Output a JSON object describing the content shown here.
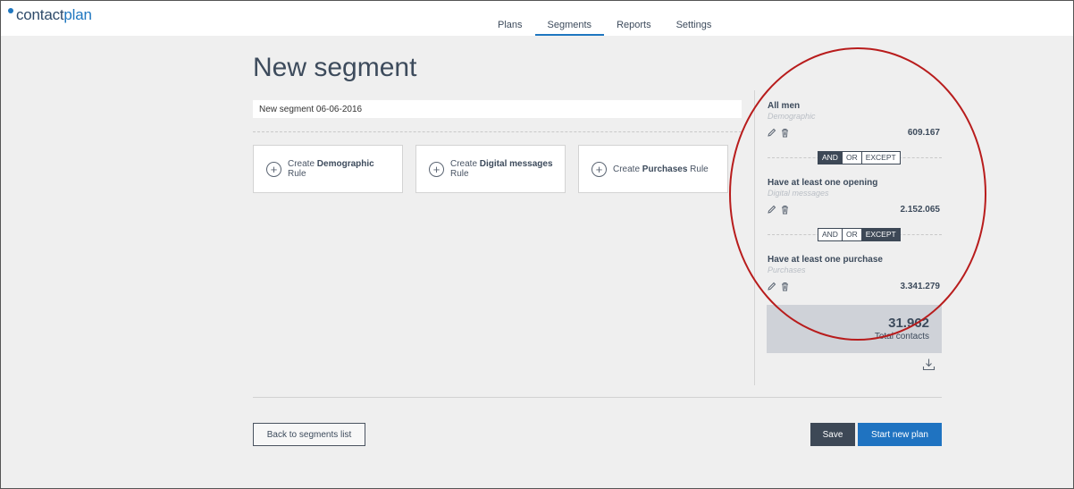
{
  "app": {
    "logo_contact": "contact",
    "logo_plan": "plan"
  },
  "nav": {
    "tabs": [
      {
        "label": "Plans",
        "active": false
      },
      {
        "label": "Segments",
        "active": true
      },
      {
        "label": "Reports",
        "active": false
      },
      {
        "label": "Settings",
        "active": false
      }
    ]
  },
  "page": {
    "title": "New segment",
    "segment_name_value": "New segment 06-06-2016"
  },
  "create_cards": [
    {
      "prefix": "Create ",
      "bold": "Demographic",
      "suffix": " Rule"
    },
    {
      "prefix": "Create ",
      "bold": "Digital messages",
      "suffix": " Rule"
    },
    {
      "prefix": "Create ",
      "bold": "Purchases",
      "suffix": " Rule"
    }
  ],
  "rules": [
    {
      "title": "All men",
      "category": "Demographic",
      "count": "609.167"
    },
    {
      "title": "Have at least one opening",
      "category": "Digital messages",
      "count": "2.152.065"
    },
    {
      "title": "Have at least one purchase",
      "category": "Purchases",
      "count": "3.341.279"
    }
  ],
  "operators": [
    {
      "options": [
        "AND",
        "OR",
        "EXCEPT"
      ],
      "selected": "AND"
    },
    {
      "options": [
        "AND",
        "OR",
        "EXCEPT"
      ],
      "selected": "EXCEPT"
    }
  ],
  "total": {
    "value": "31.962",
    "label": "Total contacts"
  },
  "footer": {
    "back_label": "Back to segments list",
    "save_label": "Save",
    "start_label": "Start new plan"
  },
  "colors": {
    "accent": "#1f73c1",
    "dark": "#3d4856",
    "annotation": "#b81c1c"
  },
  "icons": [
    "plus-circle-icon",
    "pencil-icon",
    "trash-icon",
    "download-icon"
  ]
}
